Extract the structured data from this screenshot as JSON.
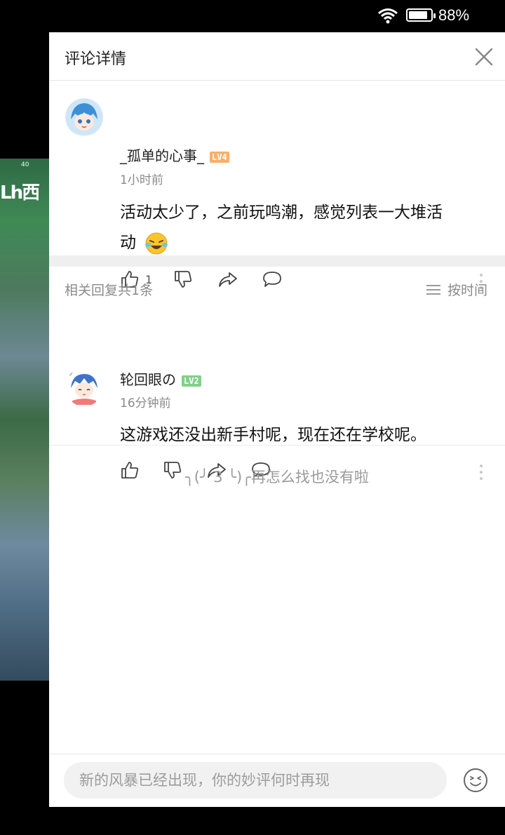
{
  "status": {
    "battery_pct_text": "88%",
    "battery_level": 0.88
  },
  "background": {
    "game_text": "Lh西",
    "small_text": "40"
  },
  "panel": {
    "title": "评论详情",
    "close_icon": "close-icon"
  },
  "main_comment": {
    "username": "_孤单的心事_",
    "level": "LV4",
    "level_color": "#f5b06b",
    "time": "1小时前",
    "text_line1": "活动太少了，之前玩鸣潮，感觉列表一大堆活",
    "text_line2": "动",
    "like_count": "1"
  },
  "replies_header": {
    "count_label": "相关回复共1条",
    "sort_label": "按时间"
  },
  "reply": {
    "username": "轮回眼の",
    "level": "LV2",
    "level_color": "#7fd18a",
    "time": "16分钟前",
    "text": "这游戏还没出新手村呢，现在还在学校呢。"
  },
  "end_message": "╮(╯ 3 ╰)╭再怎么找也没有啦",
  "input": {
    "placeholder": "新的风暴已经出现，你的妙评何时再现"
  },
  "colors": {
    "accent": "#222222",
    "muted": "#8a8a8a",
    "divider": "#efefef"
  }
}
